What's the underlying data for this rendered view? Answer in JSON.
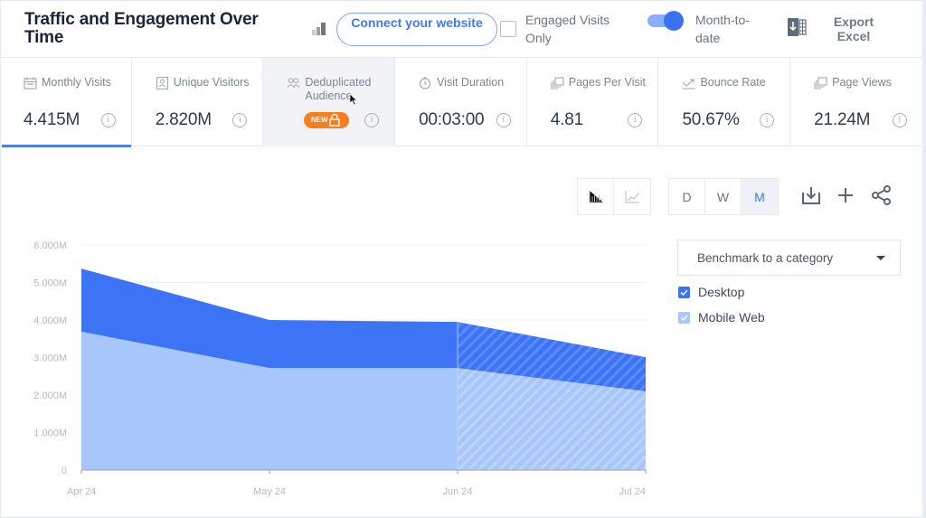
{
  "header": {
    "title": "Traffic and Engagement Over Time",
    "connect_button": "Connect your website",
    "engaged_visits": {
      "label": "Engaged Visits Only",
      "checked": false
    },
    "month_to_date": {
      "label": "Month-to-date",
      "enabled": true
    },
    "export": {
      "label": "Export Excel",
      "icon": "excel-export-icon"
    }
  },
  "metrics": [
    {
      "label": "Monthly Visits",
      "value": "4.415M",
      "icon": "calendar-icon",
      "selected": true
    },
    {
      "label": "Unique Visitors",
      "value": "2.820M",
      "icon": "user-card-icon"
    },
    {
      "label": "Deduplicated Audience",
      "value": "",
      "icon": "users-icon",
      "badge": "NEW",
      "locked": true,
      "hovered": true
    },
    {
      "label": "Visit Duration",
      "value": "00:03:00",
      "icon": "clock-icon"
    },
    {
      "label": "Pages Per Visit",
      "value": "4.81",
      "icon": "pages-icon"
    },
    {
      "label": "Bounce Rate",
      "value": "50.67%",
      "icon": "bounce-icon"
    },
    {
      "label": "Page Views",
      "value": "21.24M",
      "icon": "pages-icon"
    }
  ],
  "toolbar": {
    "chart_types": [
      {
        "name": "bar-chart",
        "icon": "bar-chart-icon",
        "active": false
      },
      {
        "name": "line-chart",
        "icon": "line-chart-icon",
        "active": false
      }
    ],
    "granularity": [
      {
        "label": "D",
        "active": false
      },
      {
        "label": "W",
        "active": false
      },
      {
        "label": "M",
        "active": true
      }
    ],
    "actions": [
      "download-icon",
      "plus-icon",
      "share-icon"
    ]
  },
  "benchmark": {
    "label": "Benchmark to a category"
  },
  "legend": [
    {
      "label": "Desktop",
      "checked": true,
      "color": "#3d74f5"
    },
    {
      "label": "Mobile Web",
      "checked": true,
      "color": "#a7c6fb"
    }
  ],
  "chart_data": {
    "type": "area",
    "stacked": true,
    "title": "",
    "xlabel": "",
    "ylabel": "",
    "categories": [
      "Apr 24",
      "May 24",
      "Jun 24",
      "Jul 24"
    ],
    "series": [
      {
        "name": "Mobile Web",
        "values": [
          3.69,
          2.72,
          2.72,
          2.1
        ],
        "color": "#a7c6fb"
      },
      {
        "name": "Desktop",
        "values": [
          1.68,
          1.28,
          1.23,
          0.91
        ],
        "color": "#3d74f5"
      }
    ],
    "unit": "M",
    "ylim": [
      0,
      6
    ],
    "yticks": [
      "0",
      "1.000M",
      "2.000M",
      "3.000M",
      "4.000M",
      "5.000M",
      "6.000M"
    ],
    "grid": true,
    "partial_period_from": "Jun 24",
    "legend_position": "right"
  }
}
